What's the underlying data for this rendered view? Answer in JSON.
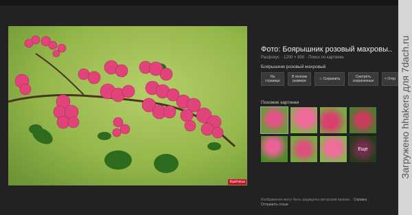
{
  "image": {
    "watermark": "RasFokus"
  },
  "info": {
    "title": "Фото: Боярышник розовый махровы..",
    "source": "Расфокус",
    "dimensions": "1200 × 800",
    "search_link": "Поиск по картинке",
    "caption": "Боярышник розовый махровый"
  },
  "buttons": {
    "open": "На странице",
    "full": "В полном размере",
    "save": "Сохранить",
    "saved": "Смотреть сохраненные",
    "share": "Отпр"
  },
  "similar": {
    "label": "Похожие картинки",
    "more": "Еще"
  },
  "footer": {
    "text": "Изображения могут быть защищены авторским правом.",
    "help": "Справка",
    "feedback": "Отправить отзыв"
  },
  "side_watermark": "Загружено hhakers для 7dach.ru",
  "colors": {
    "background": "#222222",
    "flower": "#e0447a",
    "leaf": "#2f6b1e"
  }
}
